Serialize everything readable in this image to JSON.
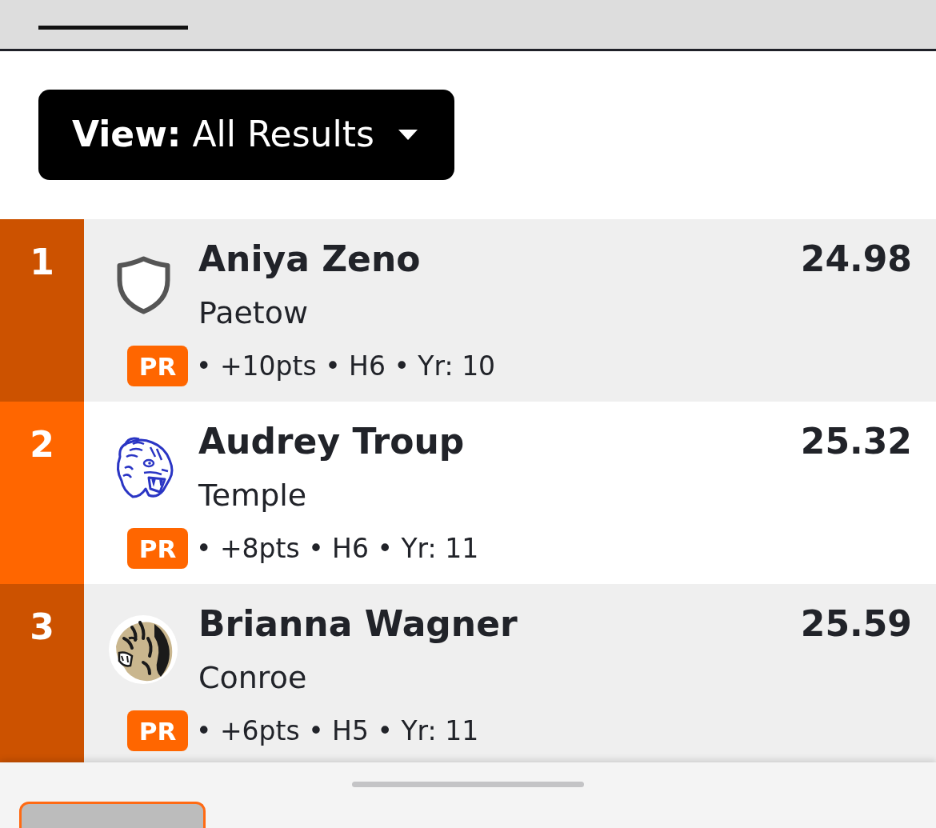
{
  "view_button": {
    "label": "**View:** All Results"
  },
  "results": [
    {
      "rank": "1",
      "logo": {
        "kind": "shield"
      },
      "name": "Aniya Zeno",
      "school": "Paetow",
      "badge": "PR",
      "details": "• +10pts • H6 • Yr: 10",
      "time": "24.98"
    },
    {
      "rank": "2",
      "logo": {
        "kind": "wildcat"
      },
      "name": "Audrey Troup",
      "school": "Temple",
      "badge": "PR",
      "details": "• +8pts • H6 • Yr: 11",
      "time": "25.32"
    },
    {
      "rank": "3",
      "logo": {
        "kind": "tiger"
      },
      "name": "Brianna Wagner",
      "school": "Conroe",
      "badge": "PR",
      "details": "• +6pts • H5 • Yr: 11",
      "time": "25.59"
    }
  ]
}
